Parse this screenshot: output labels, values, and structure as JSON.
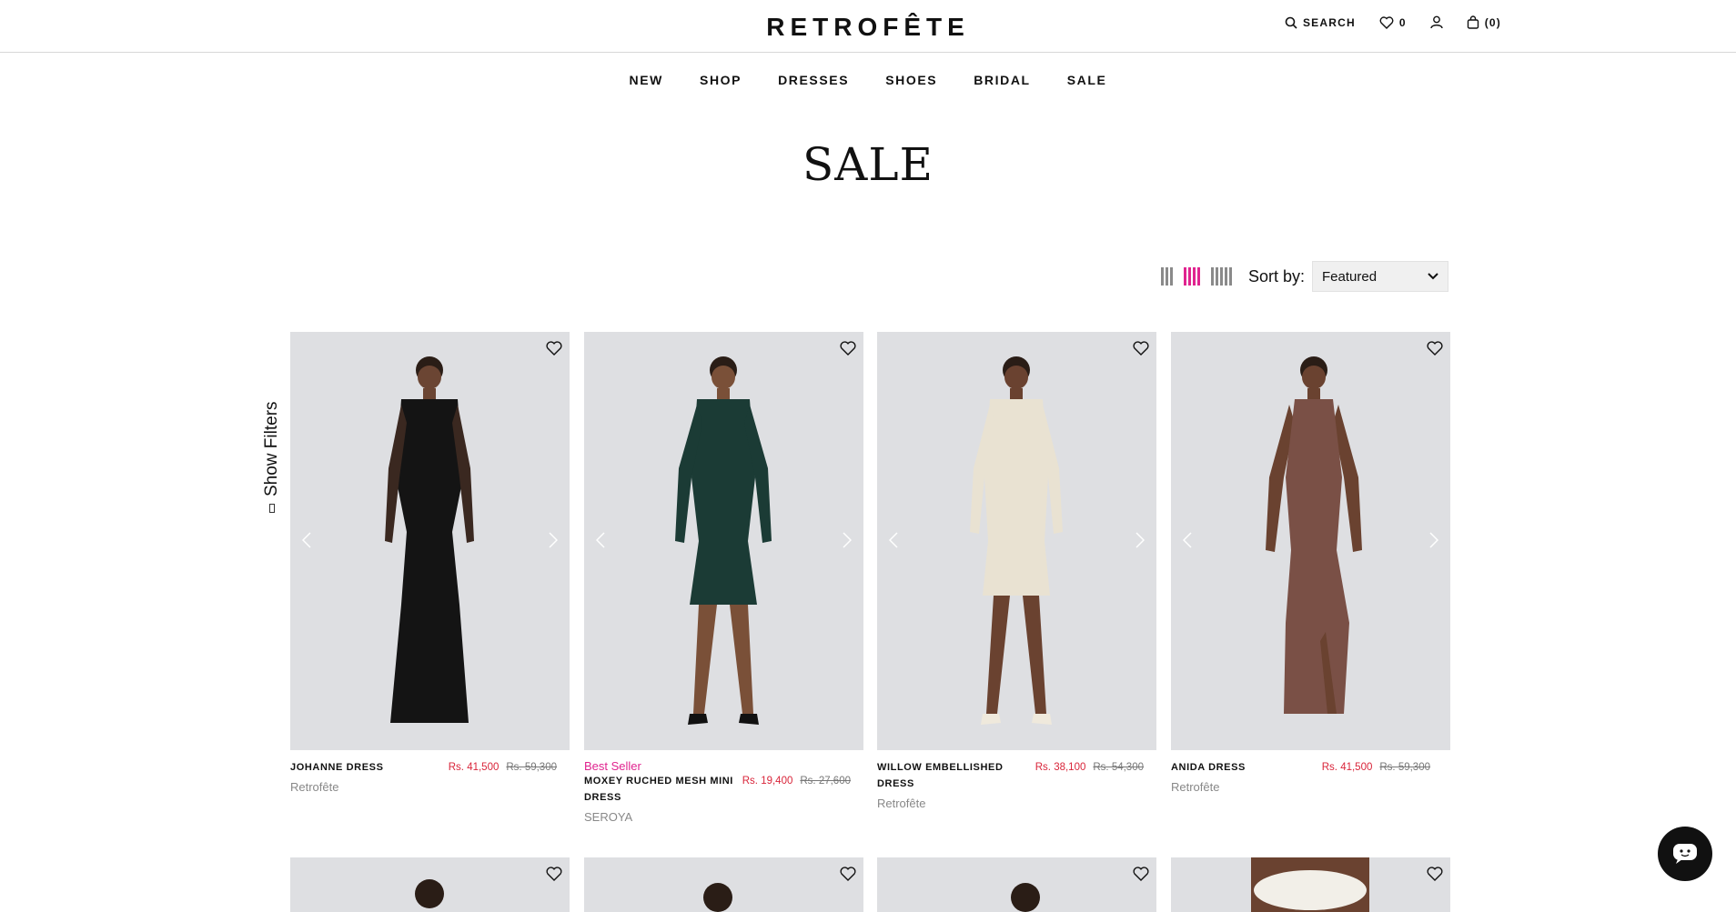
{
  "header": {
    "logo": "RETROFÊTE",
    "search_label": "SEARCH",
    "wishlist_count": "0",
    "cart_label": "(0)"
  },
  "nav": [
    "NEW",
    "SHOP",
    "DRESSES",
    "SHOES",
    "BRIDAL",
    "SALE"
  ],
  "page_title": "SALE",
  "toolbar": {
    "sort_label": "Sort by:",
    "sort_value": "Featured",
    "active_grid": 1
  },
  "filters": {
    "label": "Show Filters"
  },
  "products": [
    {
      "badge": "",
      "name": "JOHANNE DRESS",
      "price": "Rs. 41,500",
      "original_price": "Rs. 59,300",
      "brand": "Retrofête",
      "dress_color": "#141414"
    },
    {
      "badge": "Best Seller",
      "name": "MOXEY RUCHED MESH MINI DRESS",
      "price": "Rs. 19,400",
      "original_price": "Rs. 27,600",
      "brand": "SEROYA",
      "dress_color": "#1b3b35"
    },
    {
      "badge": "",
      "name": "WILLOW EMBELLISHED DRESS",
      "price": "Rs. 38,100",
      "original_price": "Rs. 54,300",
      "brand": "Retrofête",
      "dress_color": "#e9e2d2"
    },
    {
      "badge": "",
      "name": "ANIDA DRESS",
      "price": "Rs. 41,500",
      "original_price": "Rs. 59,300",
      "brand": "Retrofête",
      "dress_color": "#7a5046"
    }
  ],
  "colors": {
    "accent": "#e0248f",
    "sale_price": "#d9253a"
  }
}
